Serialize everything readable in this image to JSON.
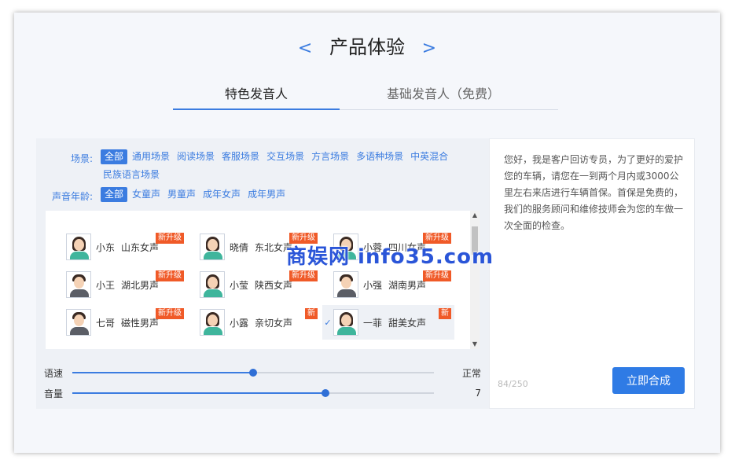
{
  "header": {
    "title": "产品体验",
    "prev_arrow": "<",
    "next_arrow": ">"
  },
  "tabs": [
    {
      "label": "特色发音人",
      "active": true
    },
    {
      "label": "基础发音人（免费）",
      "active": false
    }
  ],
  "filters": {
    "scene": {
      "label": "场景:",
      "options": [
        "全部",
        "通用场景",
        "阅读场景",
        "客服场景",
        "交互场景",
        "方言场景",
        "多语种场景",
        "中英混合",
        "民族语言场景"
      ],
      "selected": "全部"
    },
    "age": {
      "label": "声音年龄:",
      "options": [
        "全部",
        "女童声",
        "男童声",
        "成年女声",
        "成年男声"
      ],
      "selected": "全部"
    }
  },
  "voices": [
    {
      "name": "小东",
      "desc": "山东女声",
      "badge": "新升级",
      "gender": "female"
    },
    {
      "name": "晓倩",
      "desc": "东北女声",
      "badge": "新升级",
      "gender": "female"
    },
    {
      "name": "小蓉",
      "desc": "四川女声",
      "badge": "新升级",
      "gender": "female"
    },
    {
      "name": "小王",
      "desc": "湖北男声",
      "badge": "新升级",
      "gender": "male"
    },
    {
      "name": "小莹",
      "desc": "陕西女声",
      "badge": "新升级",
      "gender": "female"
    },
    {
      "name": "小强",
      "desc": "湖南男声",
      "badge": "新升级",
      "gender": "male"
    },
    {
      "name": "七哥",
      "desc": "磁性男声",
      "badge": "新升级",
      "gender": "male"
    },
    {
      "name": "小露",
      "desc": "亲切女声",
      "badge": "新",
      "gender": "female"
    },
    {
      "name": "一菲",
      "desc": "甜美女声",
      "badge": "新",
      "gender": "female",
      "selected": true,
      "check": "✓"
    }
  ],
  "sliders": {
    "speed": {
      "label": "语速",
      "value_text": "正常",
      "level": 0.5
    },
    "volume": {
      "label": "音量",
      "value_text": "7",
      "level": 0.7
    }
  },
  "text_panel": {
    "content": "您好，我是客户回访专员，为了更好的爱护您的车辆，请您在一到两个月内或3000公里左右来店进行车辆首保。首保是免费的，我们的服务顾问和维修技师会为您的车做一次全面的检查。",
    "counter": "84/250",
    "synthesize_label": "立即合成"
  },
  "watermark": "商娱网 info35.com",
  "colors": {
    "accent": "#3b7ce0",
    "badge": "#f05a28",
    "button": "#2f7be5"
  }
}
